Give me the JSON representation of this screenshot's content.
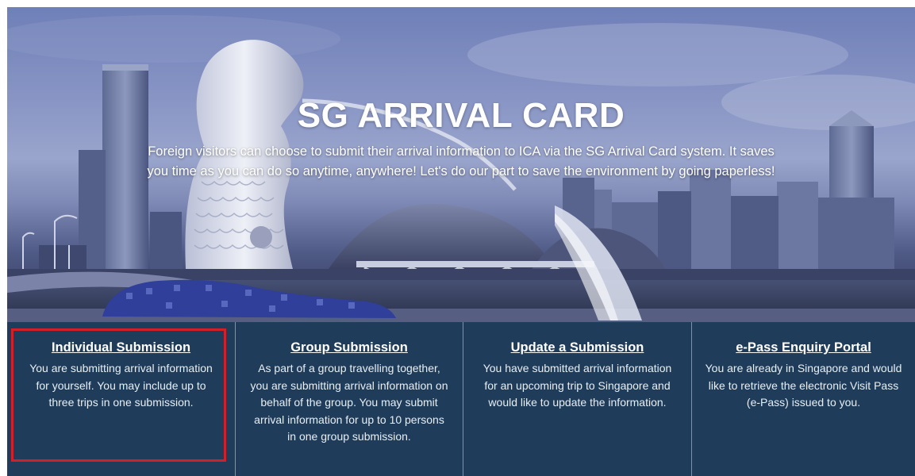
{
  "hero": {
    "title": "SG ARRIVAL CARD",
    "description": "Foreign visitors can choose to submit their arrival information to ICA via the SG Arrival Card system. It saves you time as you can do so anytime, anywhere! Let's do our part to save the environment by going paperless!",
    "background_image": "singapore-skyline-merlion"
  },
  "options": [
    {
      "title": "Individual Submission",
      "description": "You are submitting arrival information for yourself. You may include up to three trips in one submission.",
      "highlighted": true
    },
    {
      "title": "Group Submission",
      "description": "As part of a group travelling together, you are submitting arrival information on behalf of the group. You may submit arrival information for up to 10 persons in one group submission."
    },
    {
      "title": "Update a Submission",
      "description": "You have submitted arrival information for an upcoming trip to Singapore and would like to update the information."
    },
    {
      "title": "e-Pass Enquiry Portal",
      "description": "You are already in Singapore and would like to retrieve the electronic Visit Pass (e-Pass) issued to you."
    }
  ],
  "colors": {
    "panel_background": "#1f3d5a",
    "panel_divider": "#7f93a8",
    "highlight_border": "#d0202a",
    "text": "#ffffff"
  }
}
